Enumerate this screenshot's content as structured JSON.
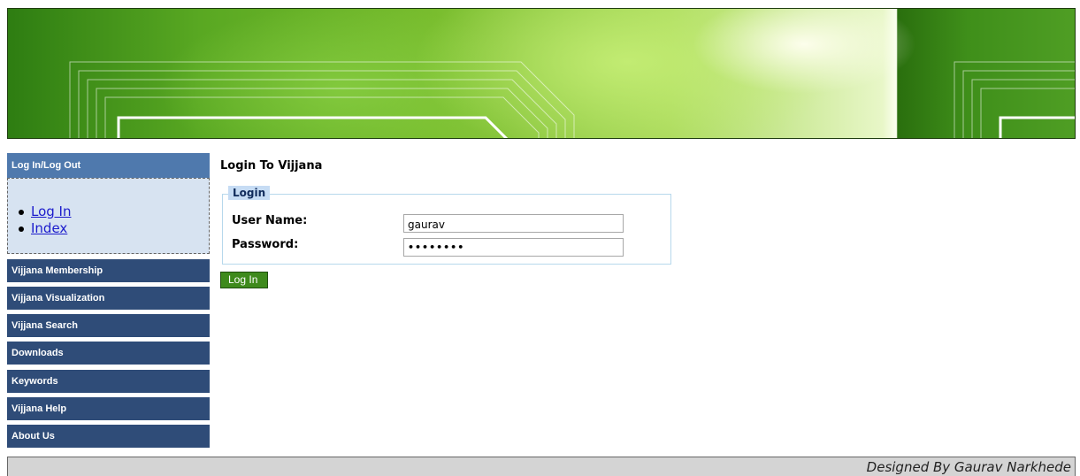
{
  "sidebar": {
    "header": "Log In/Log Out",
    "links": [
      "Log In",
      "Index"
    ],
    "nav": [
      "Vijjana Membership",
      "Vijjana Visualization",
      "Vijjana Search",
      "Downloads",
      "Keywords",
      "Vijjana Help",
      "About Us"
    ]
  },
  "main": {
    "title": "Login To Vijjana",
    "legend": "Login",
    "username_label": "User Name:",
    "username_value": "gaurav",
    "password_label": "Password:",
    "password_value": "••••••••",
    "login_button": "Log In"
  },
  "footer": {
    "credit": "Designed By Gaurav Narkhede"
  }
}
